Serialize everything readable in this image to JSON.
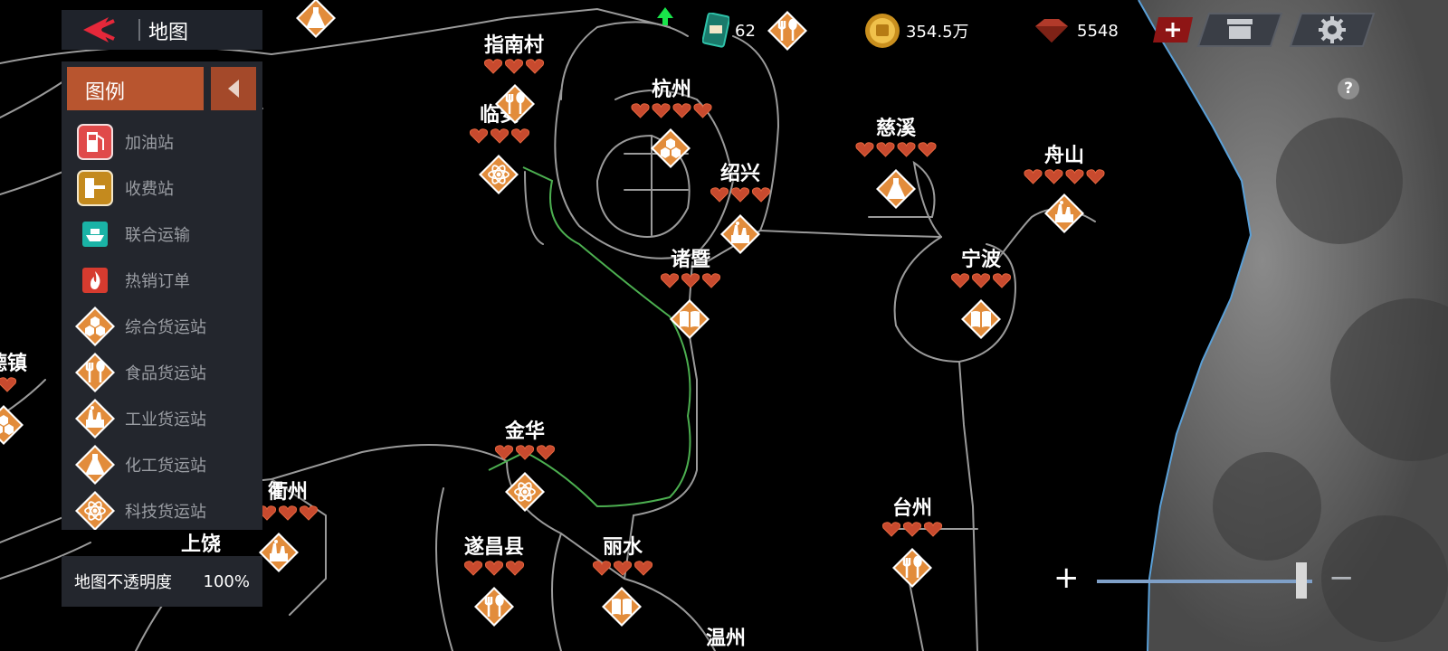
{
  "header": {
    "title": "地图"
  },
  "topbar": {
    "truck_count": "62",
    "coins": "354.5万",
    "gems": "5548",
    "add_label": "+"
  },
  "legend": {
    "title": "图例",
    "items": [
      {
        "label": "加油站",
        "icon": "fuel-pump-icon"
      },
      {
        "label": "收费站",
        "icon": "toll-booth-icon"
      },
      {
        "label": "联合运输",
        "icon": "ship-icon"
      },
      {
        "label": "热销订单",
        "icon": "fire-icon"
      },
      {
        "label": "综合货运站",
        "icon": "hexagons-icon"
      },
      {
        "label": "食品货运站",
        "icon": "fork-spoon-icon"
      },
      {
        "label": "工业货运站",
        "icon": "factory-icon"
      },
      {
        "label": "化工货运站",
        "icon": "flask-icon"
      },
      {
        "label": "科技货运站",
        "icon": "atom-icon"
      }
    ]
  },
  "opacity": {
    "label": "地图不透明度",
    "value": "100%"
  },
  "zoom": {
    "level": 0.95,
    "plus": "+",
    "minus": "−"
  },
  "help": "?",
  "cities": [
    {
      "name": "指南村",
      "hearts": 3
    },
    {
      "name": "杭州",
      "hearts": 4
    },
    {
      "name": "临安",
      "hearts": 3
    },
    {
      "name": "绍兴",
      "hearts": 3
    },
    {
      "name": "慈溪",
      "hearts": 4
    },
    {
      "name": "舟山",
      "hearts": 4
    },
    {
      "name": "诸暨",
      "hearts": 3
    },
    {
      "name": "宁波",
      "hearts": 3
    },
    {
      "name": "德镇",
      "hearts": 1
    },
    {
      "name": "金华",
      "hearts": 3
    },
    {
      "name": "衢州",
      "hearts": 3
    },
    {
      "name": "上饶",
      "hearts": 0
    },
    {
      "name": "遂昌县",
      "hearts": 3
    },
    {
      "name": "丽水",
      "hearts": 3
    },
    {
      "name": "台州",
      "hearts": 3
    },
    {
      "name": "温州",
      "hearts": 0
    }
  ],
  "colors": {
    "station": "#e28c3b",
    "heart": "#c84a2e",
    "legend_header": "#b8552f",
    "panel": "#23262d",
    "ocean_border": "#5aa0d8"
  }
}
